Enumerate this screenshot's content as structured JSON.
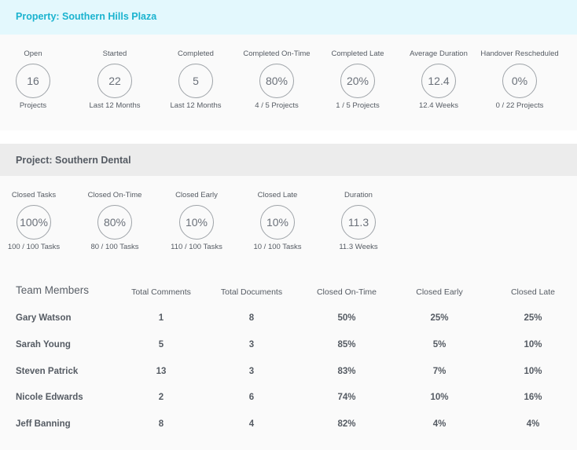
{
  "property": {
    "title": "Property: Southern Hills Plaza"
  },
  "property_stats": [
    {
      "label": "Open",
      "value": "16",
      "sub": "Projects"
    },
    {
      "label": "Started",
      "value": "22",
      "sub": "Last 12 Months"
    },
    {
      "label": "Completed",
      "value": "5",
      "sub": "Last 12 Months"
    },
    {
      "label": "Completed On-Time",
      "value": "80%",
      "sub": "4 / 5 Projects"
    },
    {
      "label": "Completed Late",
      "value": "20%",
      "sub": "1 / 5 Projects"
    },
    {
      "label": "Average Duration",
      "value": "12.4",
      "sub": "12.4 Weeks"
    },
    {
      "label": "Handover Rescheduled",
      "value": "0%",
      "sub": "0 / 22 Projects"
    }
  ],
  "project": {
    "title": "Project: Southern Dental"
  },
  "project_stats": [
    {
      "label": "Closed Tasks",
      "value": "100%",
      "sub": "100 / 100 Tasks"
    },
    {
      "label": "Closed On-Time",
      "value": "80%",
      "sub": "80 / 100 Tasks"
    },
    {
      "label": "Closed Early",
      "value": "10%",
      "sub": "110 / 100 Tasks"
    },
    {
      "label": "Closed Late",
      "value": "10%",
      "sub": "10 / 100 Tasks"
    },
    {
      "label": "Duration",
      "value": "11.3",
      "sub": "11.3 Weeks"
    }
  ],
  "team": {
    "columns": [
      "Team Members",
      "Total Comments",
      "Total Documents",
      "Closed On-Time",
      "Closed Early",
      "Closed Late"
    ],
    "rows": [
      [
        "Gary Watson",
        "1",
        "8",
        "50%",
        "25%",
        "25%"
      ],
      [
        "Sarah Young",
        "5",
        "3",
        "85%",
        "5%",
        "10%"
      ],
      [
        "Steven Patrick",
        "13",
        "3",
        "83%",
        "7%",
        "10%"
      ],
      [
        "Nicole Edwards",
        "2",
        "6",
        "74%",
        "10%",
        "16%"
      ],
      [
        "Jeff Banning",
        "8",
        "4",
        "82%",
        "4%",
        "4%"
      ]
    ]
  },
  "colors": {
    "property_header_bg": "#e3f8fd",
    "property_title": "#1bb3cf",
    "project_header_bg": "#ececec"
  }
}
